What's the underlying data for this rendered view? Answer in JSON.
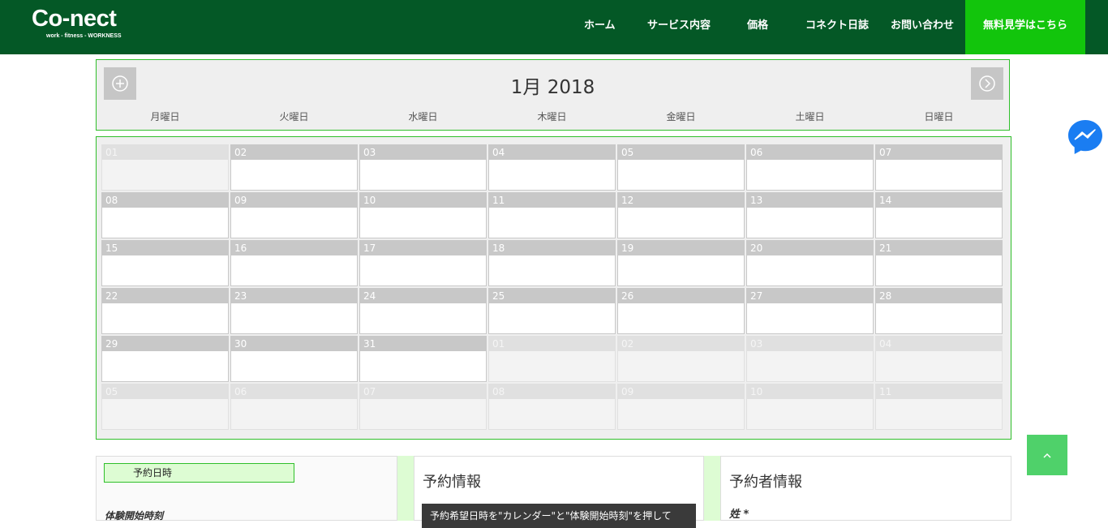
{
  "logo": {
    "main": "Co-nect",
    "sub": "work - fitness - WORKNESS"
  },
  "nav": {
    "items": [
      "ホーム",
      "サービス内容",
      "価格",
      "コネクト日誌",
      "お問い合わせ"
    ],
    "cta": "無料見学はこちら"
  },
  "calendar": {
    "title": "1月 2018",
    "weekdays": [
      "月曜日",
      "火曜日",
      "水曜日",
      "木曜日",
      "金曜日",
      "土曜日",
      "日曜日"
    ],
    "weeks": [
      [
        "01",
        "02",
        "03",
        "04",
        "05",
        "06",
        "07"
      ],
      [
        "08",
        "09",
        "10",
        "11",
        "12",
        "13",
        "14"
      ],
      [
        "15",
        "16",
        "17",
        "18",
        "19",
        "20",
        "21"
      ],
      [
        "22",
        "23",
        "24",
        "25",
        "26",
        "27",
        "28"
      ],
      [
        "29",
        "30",
        "31",
        "01",
        "02",
        "03",
        "04"
      ],
      [
        "05",
        "06",
        "07",
        "08",
        "09",
        "10",
        "11"
      ]
    ]
  },
  "panels": {
    "datetime": {
      "tag": "予約日時",
      "label": "体験開始時刻"
    },
    "info": {
      "title": "予約情報",
      "notice": "予約希望日時を\"カレンダー\"と\"体験開始時刻\"を押して"
    },
    "booker": {
      "title": "予約者情報",
      "field": "姓 *"
    }
  },
  "colors": {
    "header": "#045826",
    "accent": "#12c50c",
    "border": "#2fbf2a",
    "tag_bg": "#ddfcd3"
  },
  "icons": {
    "prev": "plus-circle-icon",
    "next": "chevron-right-circle-icon",
    "messenger": "messenger-icon",
    "to_top": "chevron-up-icon"
  }
}
